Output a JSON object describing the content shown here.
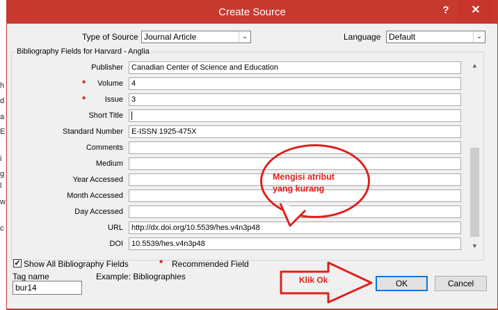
{
  "background_doc_chars": [
    "h",
    "d",
    "a",
    "E",
    "i",
    "g",
    "l",
    "w",
    "c"
  ],
  "dialog": {
    "title": "Create Source",
    "help": "?",
    "close": "✕"
  },
  "top": {
    "type_label": "Type of Source",
    "type_value": "Journal Article",
    "language_label": "Language",
    "language_value": "Default"
  },
  "group_title": "Bibliography Fields for Harvard - Anglia",
  "fields": [
    {
      "label": "Publisher",
      "value": "Canadian Center of Science and Education",
      "recommended": false
    },
    {
      "label": "Volume",
      "value": "4",
      "recommended": true
    },
    {
      "label": "Issue",
      "value": "3",
      "recommended": true
    },
    {
      "label": "Short Title",
      "value": "",
      "recommended": false
    },
    {
      "label": "Standard Number",
      "value": "E-ISSN 1925-475X",
      "recommended": false
    },
    {
      "label": "Comments",
      "value": "",
      "recommended": false
    },
    {
      "label": "Medium",
      "value": "",
      "recommended": false
    },
    {
      "label": "Year Accessed",
      "value": "",
      "recommended": false
    },
    {
      "label": "Month Accessed",
      "value": "",
      "recommended": false
    },
    {
      "label": "Day Accessed",
      "value": "",
      "recommended": false
    },
    {
      "label": "URL",
      "value": "http://dx.doi.org/10.5539/hes.v4n3p48",
      "recommended": false
    },
    {
      "label": "DOI",
      "value": "10.5539/hes.v4n3p48",
      "recommended": false
    }
  ],
  "star": "*",
  "bottom": {
    "show_all_label": "Show All Bibliography Fields",
    "show_all_checked": "✓",
    "recommended_label": "Recommended Field",
    "tag_name_label": "Tag name",
    "tag_value": "bur14",
    "example_label": "Example: Bibliographies",
    "ok_label": "OK",
    "cancel_label": "Cancel"
  },
  "annotations": {
    "bubble_text_line1": "Mengisi atribut",
    "bubble_text_line2": "yang kurang",
    "arrow_text": "Klik Ok",
    "color": "#e0201c"
  },
  "scroll": {
    "up": "▲",
    "down": "▼"
  },
  "combo_arrow": "⌄"
}
